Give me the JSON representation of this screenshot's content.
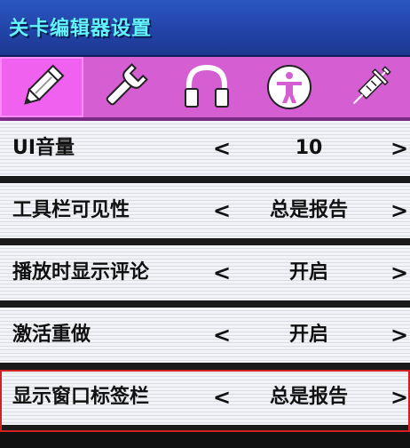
{
  "title": "关卡编辑器设置",
  "tabs": [
    {
      "icon": "pencil-icon",
      "active": true
    },
    {
      "icon": "wrench-icon",
      "active": false
    },
    {
      "icon": "headphones-icon",
      "active": false
    },
    {
      "icon": "accessibility-icon",
      "active": false
    },
    {
      "icon": "syringe-icon",
      "active": false
    }
  ],
  "settings": [
    {
      "label": "UI音量",
      "value": "10"
    },
    {
      "label": "工具栏可见性",
      "value": "总是报告"
    },
    {
      "label": "播放时显示评论",
      "value": "开启"
    },
    {
      "label": "激活重做",
      "value": "开启"
    },
    {
      "label": "显示窗口标签栏",
      "value": "总是报告",
      "selected": true
    }
  ],
  "arrows": {
    "left": "<",
    "right": ">"
  },
  "colors": {
    "title_bg": "#2344a8",
    "title_text": "#62f4ff",
    "tab_bg": "#d45ed2",
    "tab_active": "#f061ef",
    "selection_outline": "#d32020"
  }
}
